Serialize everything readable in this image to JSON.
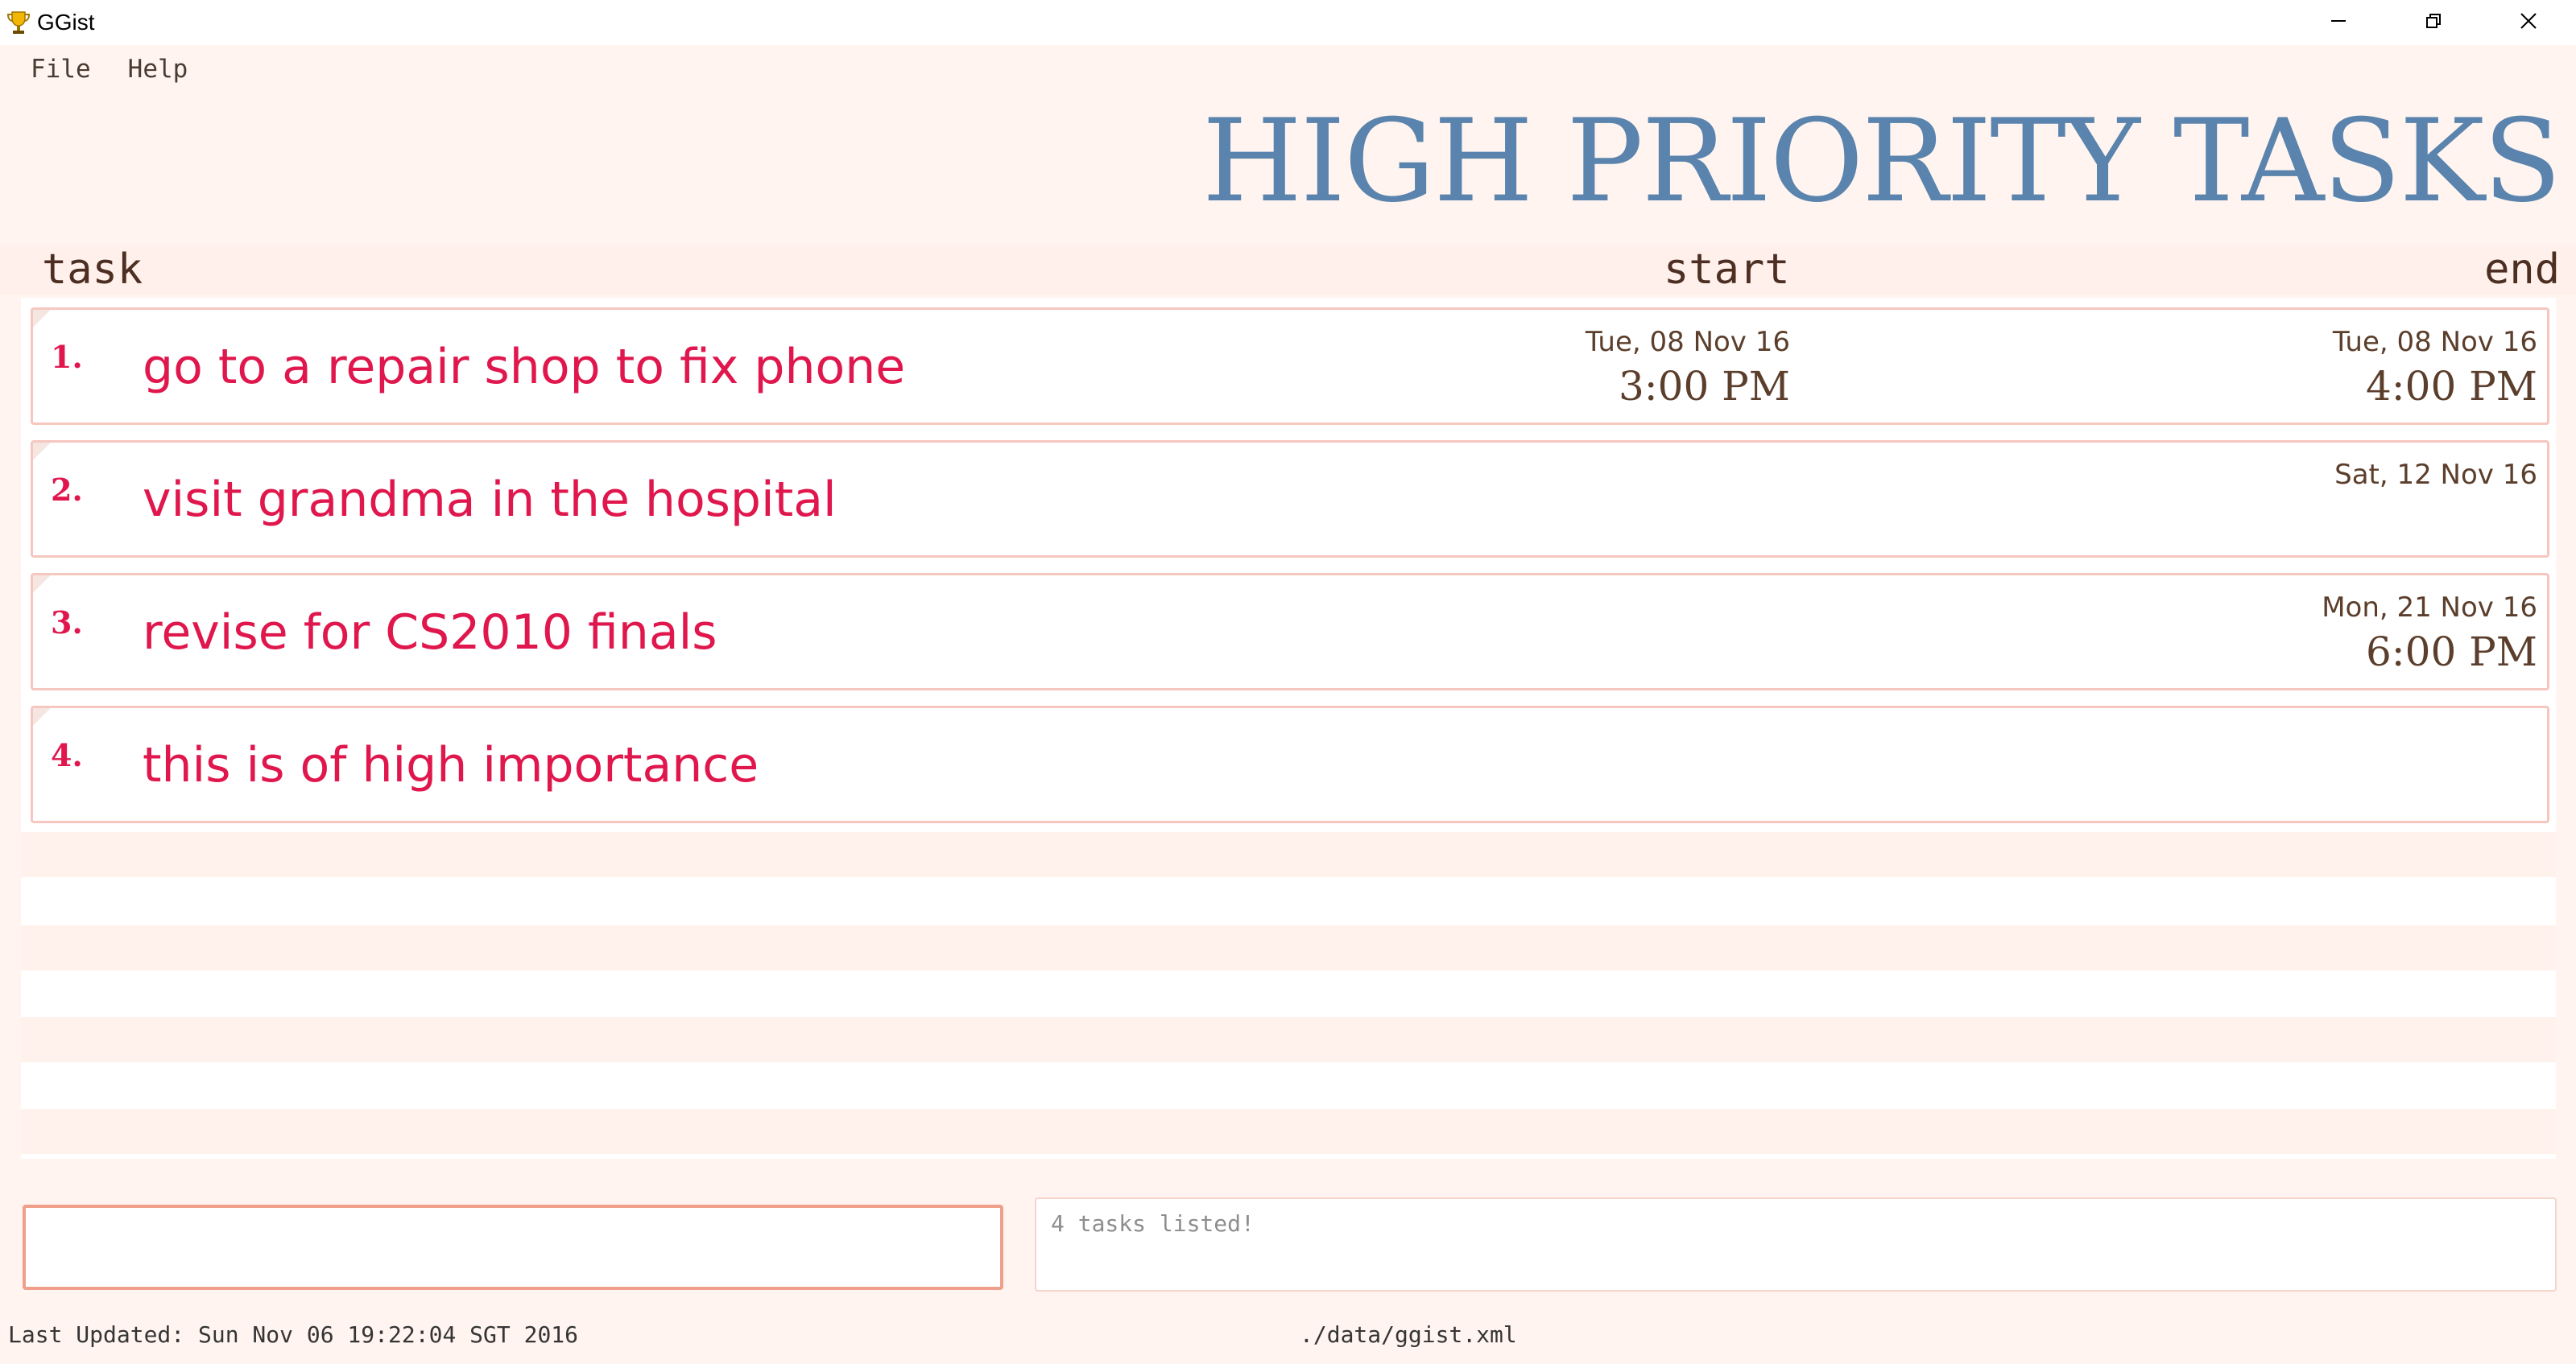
{
  "window": {
    "title": "GGist",
    "controls": [
      "minimize-icon",
      "restore-icon",
      "close-icon"
    ]
  },
  "menu": {
    "items": [
      "File",
      "Help"
    ]
  },
  "page_title": "HIGH PRIORITY TASKS",
  "columns": {
    "task": "task",
    "start": "start",
    "end": "end"
  },
  "tasks": [
    {
      "index": "1.",
      "name": "go to a repair shop to fix phone",
      "start_date": "Tue, 08 Nov 16",
      "start_time": "3:00 PM",
      "end_date": "Tue, 08 Nov 16",
      "end_time": "4:00 PM"
    },
    {
      "index": "2.",
      "name": "visit grandma in the hospital",
      "start_date": "",
      "start_time": "",
      "end_date": "Sat, 12 Nov 16",
      "end_time": ""
    },
    {
      "index": "3.",
      "name": "revise for CS2010 finals",
      "start_date": "",
      "start_time": "",
      "end_date": "Mon, 21 Nov 16",
      "end_time": "6:00 PM"
    },
    {
      "index": "4.",
      "name": "this is of high importance",
      "start_date": "",
      "start_time": "",
      "end_date": "",
      "end_time": ""
    }
  ],
  "command_input": {
    "value": "",
    "placeholder": ""
  },
  "result_message": "4 tasks listed!",
  "status": {
    "last_updated": "Last Updated: Sun Nov 06 19:22:04 SGT 2016",
    "file_path": "./data/ggist.xml"
  },
  "colors": {
    "background": "#fff4ef",
    "title": "#5a84ad",
    "task_text": "#e0174d",
    "header_text": "#4d2e22",
    "date_text": "#5b3e2b",
    "card_border": "#f5c7bf",
    "input_border": "#f0a08a"
  }
}
